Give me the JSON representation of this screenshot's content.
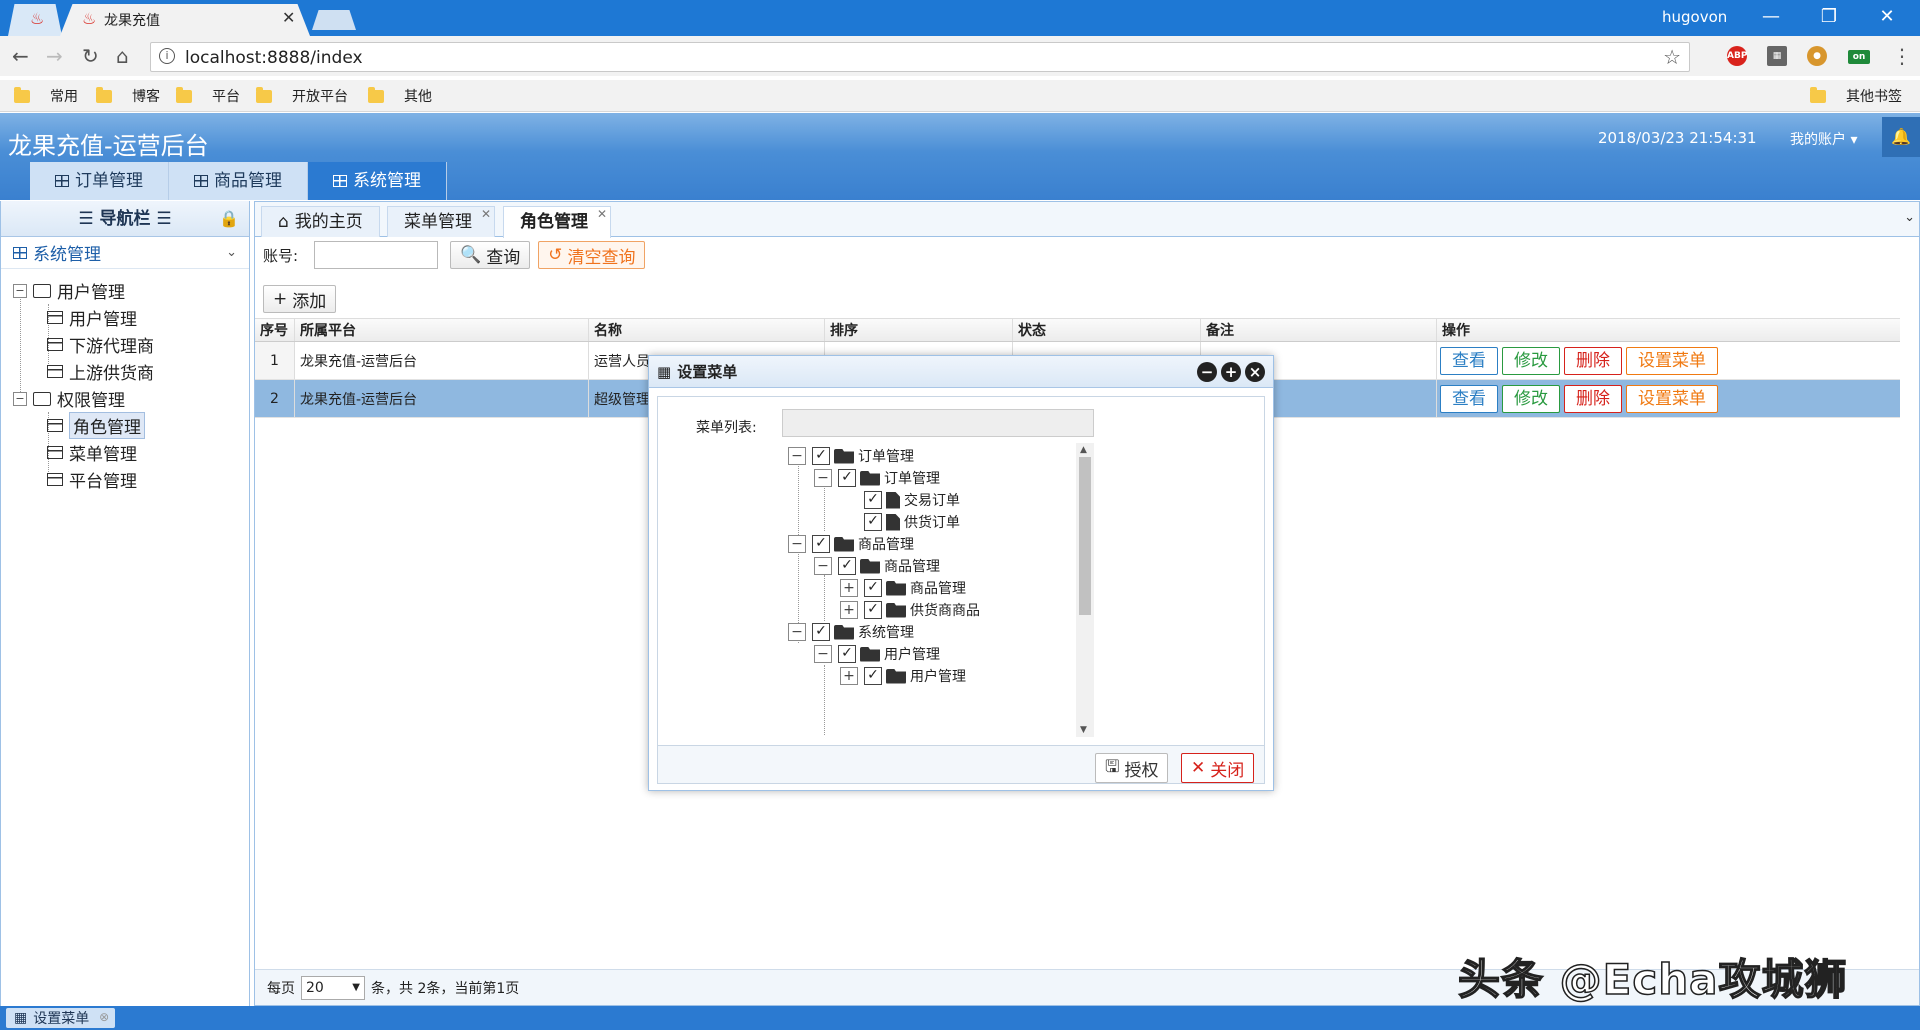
{
  "browser": {
    "tab_title": "龙果充值",
    "user": "hugovon",
    "url": "localhost:8888/index",
    "extensions": [
      "ABP",
      "on"
    ],
    "bookmarks": [
      "常用",
      "博客",
      "平台",
      "开放平台",
      "其他"
    ],
    "other_bookmarks": "其他书签"
  },
  "app": {
    "title": "龙果充值-运营后台",
    "datetime": "2018/03/23 21:54:31",
    "account": "我的账户",
    "topnav": [
      "订单管理",
      "商品管理",
      "系统管理"
    ]
  },
  "sidebar": {
    "title": "导航栏",
    "section": "系统管理",
    "groups": [
      {
        "label": "用户管理",
        "items": [
          "用户管理",
          "下游代理商",
          "上游供货商"
        ]
      },
      {
        "label": "权限管理",
        "items": [
          "角色管理",
          "菜单管理",
          "平台管理"
        ]
      }
    ]
  },
  "content_tabs": [
    "我的主页",
    "菜单管理",
    "角色管理"
  ],
  "search": {
    "label": "账号:",
    "query_btn": "查询",
    "clear_btn": "清空查询",
    "add_btn": "添加"
  },
  "grid": {
    "columns": [
      "序号",
      "所属平台",
      "名称",
      "排序",
      "状态",
      "备注",
      "操作"
    ],
    "rows": [
      {
        "no": "1",
        "platform": "龙果充值-运营后台",
        "name": "运营人员"
      },
      {
        "no": "2",
        "platform": "龙果充值-运营后台",
        "name": "超级管理"
      }
    ],
    "ops": [
      "查看",
      "修改",
      "删除",
      "设置菜单"
    ]
  },
  "pager": {
    "prefix": "每页",
    "page_size": "20",
    "summary": "条，共 2条，当前第1页"
  },
  "dialog": {
    "title": "设置菜单",
    "menu_label": "菜单列表:",
    "tree": [
      "订单管理",
      "订单管理",
      "交易订单",
      "供货订单",
      "商品管理",
      "商品管理",
      "商品管理",
      "供货商商品",
      "系统管理",
      "用户管理",
      "用户管理"
    ],
    "authorize_btn": "授权",
    "close_btn": "关闭"
  },
  "taskbar": {
    "item": "设置菜单"
  },
  "watermark": "头条 @Echa攻城狮"
}
